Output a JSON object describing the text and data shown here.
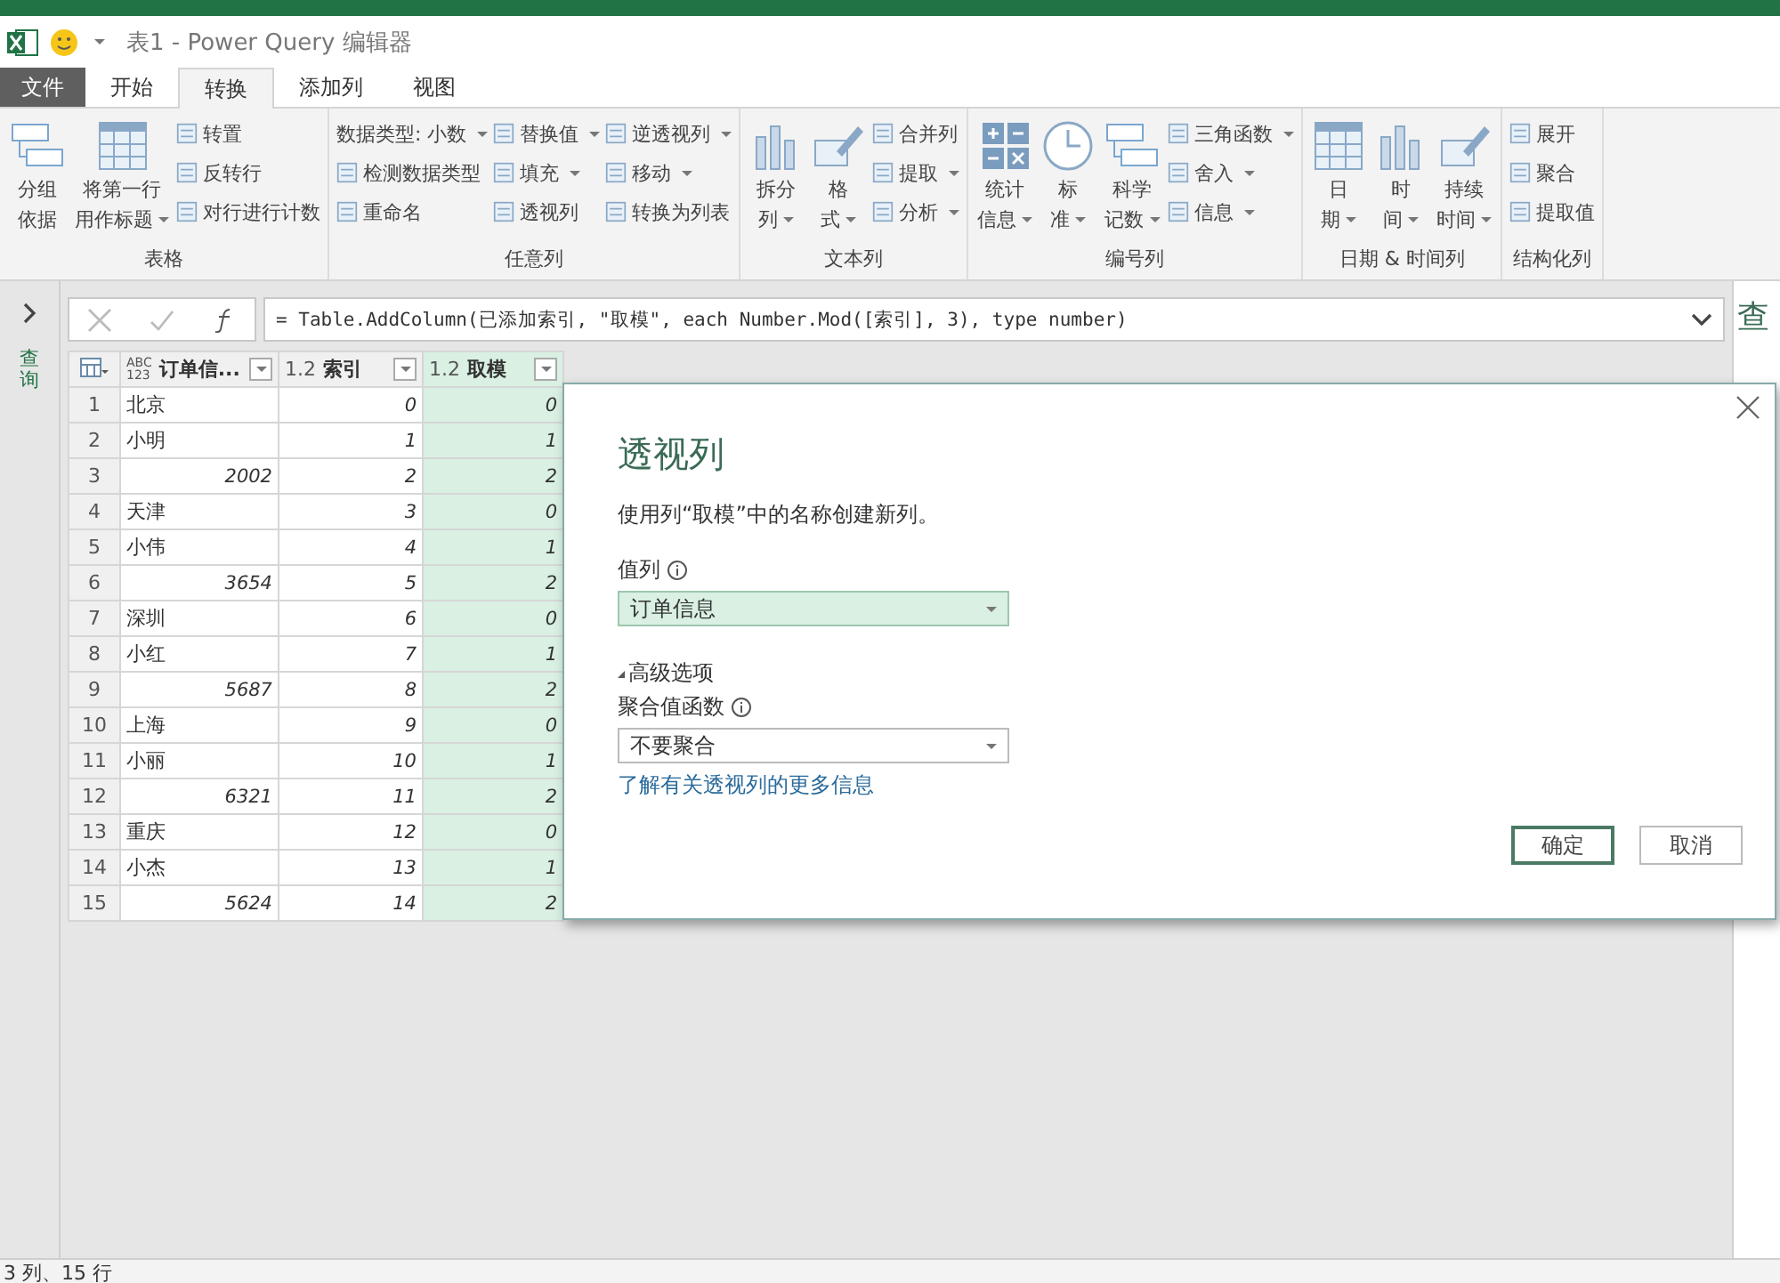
{
  "window": {
    "title": "表1 - Power Query 编辑器"
  },
  "tabs": [
    {
      "label": "文件",
      "kind": "file",
      "selected": false
    },
    {
      "label": "开始",
      "kind": "tab",
      "selected": false
    },
    {
      "label": "转换",
      "kind": "tab",
      "selected": true
    },
    {
      "label": "添加列",
      "kind": "tab",
      "selected": false
    },
    {
      "label": "视图",
      "kind": "tab",
      "selected": false
    }
  ],
  "ribbon": [
    {
      "label": "表格",
      "items": [
        {
          "kind": "large",
          "lines": [
            "分组",
            "依据"
          ],
          "dropdown": false
        },
        {
          "kind": "large",
          "lines": [
            "将第一行",
            "用作标题"
          ],
          "dropdown": true
        },
        {
          "kind": "stack",
          "rows": [
            {
              "label": "转置",
              "kind": "tool",
              "dropdown": false
            },
            {
              "label": "反转行",
              "kind": "tool",
              "dropdown": false
            },
            {
              "label": "对行进行计数",
              "kind": "tool",
              "dropdown": false
            }
          ]
        }
      ]
    },
    {
      "label": "任意列",
      "items": [
        {
          "kind": "stack",
          "rows": [
            {
              "label": "数据类型: 小数",
              "kind": "select",
              "dropdown": true
            },
            {
              "label": "检测数据类型",
              "kind": "tool",
              "dropdown": false
            },
            {
              "label": "重命名",
              "kind": "tool",
              "dropdown": false
            }
          ]
        },
        {
          "kind": "stack",
          "rows": [
            {
              "label": "替换值",
              "kind": "tool",
              "dropdown": true
            },
            {
              "label": "填充",
              "kind": "tool",
              "dropdown": true
            },
            {
              "label": "透视列",
              "kind": "tool",
              "dropdown": false
            }
          ]
        },
        {
          "kind": "stack",
          "rows": [
            {
              "label": "逆透视列",
              "kind": "tool",
              "dropdown": true
            },
            {
              "label": "移动",
              "kind": "tool",
              "dropdown": true
            },
            {
              "label": "转换为列表",
              "kind": "tool",
              "dropdown": false
            }
          ]
        }
      ]
    },
    {
      "label": "文本列",
      "items": [
        {
          "kind": "large",
          "lines": [
            "拆分",
            "列"
          ],
          "dropdown": true
        },
        {
          "kind": "large",
          "lines": [
            "格",
            "式"
          ],
          "dropdown": true
        },
        {
          "kind": "stack",
          "rows": [
            {
              "label": "合并列",
              "kind": "tool",
              "dropdown": false
            },
            {
              "label": "提取",
              "kind": "tool",
              "dropdown": true
            },
            {
              "label": "分析",
              "kind": "tool",
              "dropdown": true
            }
          ]
        }
      ]
    },
    {
      "label": "编号列",
      "items": [
        {
          "kind": "large",
          "lines": [
            "统计",
            "信息"
          ],
          "dropdown": true
        },
        {
          "kind": "large",
          "lines": [
            "标",
            "准"
          ],
          "dropdown": true
        },
        {
          "kind": "large",
          "lines": [
            "科学",
            "记数"
          ],
          "dropdown": true
        },
        {
          "kind": "stack",
          "rows": [
            {
              "label": "三角函数",
              "kind": "tool",
              "dropdown": true
            },
            {
              "label": "舍入",
              "kind": "tool",
              "dropdown": true
            },
            {
              "label": "信息",
              "kind": "tool",
              "dropdown": true
            }
          ]
        }
      ]
    },
    {
      "label": "日期 & 时间列",
      "items": [
        {
          "kind": "large",
          "lines": [
            "日",
            "期"
          ],
          "dropdown": true
        },
        {
          "kind": "large",
          "lines": [
            "时",
            "间"
          ],
          "dropdown": true
        },
        {
          "kind": "large",
          "lines": [
            "持续",
            "时间"
          ],
          "dropdown": true
        }
      ]
    },
    {
      "label": "结构化列",
      "items": [
        {
          "kind": "stack",
          "rows": [
            {
              "label": "展开",
              "kind": "tool",
              "dropdown": false
            },
            {
              "label": "聚合",
              "kind": "tool",
              "dropdown": false
            },
            {
              "label": "提取值",
              "kind": "tool",
              "dropdown": false
            }
          ]
        }
      ]
    }
  ],
  "queries_pane": {
    "label": "查询"
  },
  "formula_bar": {
    "formula": "= Table.AddColumn(已添加索引, \"取模\", each Number.Mod([索引], 3), type number)"
  },
  "table": {
    "columns": [
      {
        "type_lines": [
          "ABC",
          "123"
        ],
        "name": "订单信...",
        "selected": false
      },
      {
        "type_lines": [
          "1.2"
        ],
        "name": "索引",
        "selected": false
      },
      {
        "type_lines": [
          "1.2"
        ],
        "name": "取模",
        "selected": true
      }
    ],
    "rows": [
      {
        "n": "1",
        "cells": [
          {
            "text": "北京",
            "kind": "text"
          },
          {
            "text": "0",
            "kind": "number"
          },
          {
            "text": "0",
            "kind": "number"
          }
        ]
      },
      {
        "n": "2",
        "cells": [
          {
            "text": "小明",
            "kind": "text"
          },
          {
            "text": "1",
            "kind": "number"
          },
          {
            "text": "1",
            "kind": "number"
          }
        ]
      },
      {
        "n": "3",
        "cells": [
          {
            "text": "2002",
            "kind": "number"
          },
          {
            "text": "2",
            "kind": "number"
          },
          {
            "text": "2",
            "kind": "number"
          }
        ]
      },
      {
        "n": "4",
        "cells": [
          {
            "text": "天津",
            "kind": "text"
          },
          {
            "text": "3",
            "kind": "number"
          },
          {
            "text": "0",
            "kind": "number"
          }
        ]
      },
      {
        "n": "5",
        "cells": [
          {
            "text": "小伟",
            "kind": "text"
          },
          {
            "text": "4",
            "kind": "number"
          },
          {
            "text": "1",
            "kind": "number"
          }
        ]
      },
      {
        "n": "6",
        "cells": [
          {
            "text": "3654",
            "kind": "number"
          },
          {
            "text": "5",
            "kind": "number"
          },
          {
            "text": "2",
            "kind": "number"
          }
        ]
      },
      {
        "n": "7",
        "cells": [
          {
            "text": "深圳",
            "kind": "text"
          },
          {
            "text": "6",
            "kind": "number"
          },
          {
            "text": "0",
            "kind": "number"
          }
        ]
      },
      {
        "n": "8",
        "cells": [
          {
            "text": "小红",
            "kind": "text"
          },
          {
            "text": "7",
            "kind": "number"
          },
          {
            "text": "1",
            "kind": "number"
          }
        ]
      },
      {
        "n": "9",
        "cells": [
          {
            "text": "5687",
            "kind": "number"
          },
          {
            "text": "8",
            "kind": "number"
          },
          {
            "text": "2",
            "kind": "number"
          }
        ]
      },
      {
        "n": "10",
        "cells": [
          {
            "text": "上海",
            "kind": "text"
          },
          {
            "text": "9",
            "kind": "number"
          },
          {
            "text": "0",
            "kind": "number"
          }
        ]
      },
      {
        "n": "11",
        "cells": [
          {
            "text": "小丽",
            "kind": "text"
          },
          {
            "text": "10",
            "kind": "number"
          },
          {
            "text": "1",
            "kind": "number"
          }
        ]
      },
      {
        "n": "12",
        "cells": [
          {
            "text": "6321",
            "kind": "number"
          },
          {
            "text": "11",
            "kind": "number"
          },
          {
            "text": "2",
            "kind": "number"
          }
        ]
      },
      {
        "n": "13",
        "cells": [
          {
            "text": "重庆",
            "kind": "text"
          },
          {
            "text": "12",
            "kind": "number"
          },
          {
            "text": "0",
            "kind": "number"
          }
        ]
      },
      {
        "n": "14",
        "cells": [
          {
            "text": "小杰",
            "kind": "text"
          },
          {
            "text": "13",
            "kind": "number"
          },
          {
            "text": "1",
            "kind": "number"
          }
        ]
      },
      {
        "n": "15",
        "cells": [
          {
            "text": "5624",
            "kind": "number"
          },
          {
            "text": "14",
            "kind": "number"
          },
          {
            "text": "2",
            "kind": "number"
          }
        ]
      }
    ]
  },
  "dialog": {
    "title": "透视列",
    "description": "使用列“取模”中的名称创建新列。",
    "value_field": {
      "label": "值列",
      "value": "订单信息",
      "focused": true
    },
    "advanced": {
      "label": "高级选项",
      "expanded": true
    },
    "aggregate_field": {
      "label": "聚合值函数",
      "value": "不要聚合",
      "focused": false
    },
    "link": "了解有关透视列的更多信息",
    "buttons": [
      {
        "label": "确定",
        "default": true
      },
      {
        "label": "取消",
        "default": false
      }
    ]
  },
  "settings_pane": {
    "title": "查"
  },
  "status_bar": {
    "text": "3 列、15 行"
  }
}
